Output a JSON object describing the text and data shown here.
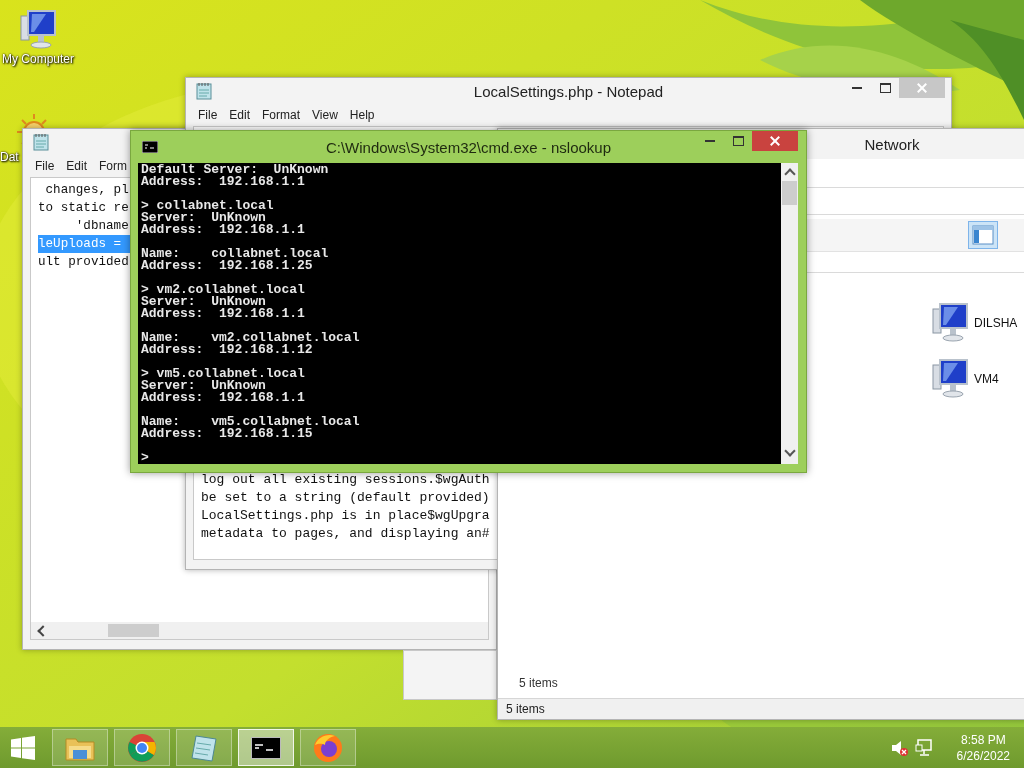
{
  "desktop": {
    "icons": [
      {
        "label": "My Computer",
        "kind": "computer"
      },
      {
        "label": "Dat",
        "kind": "sun"
      }
    ]
  },
  "notepad_left": {
    "menu": [
      "File",
      "Edit",
      "Form"
    ],
    "lines": [
      {
        "text": " changes, pl",
        "selected": false
      },
      {
        "text": "to static re",
        "selected": false
      },
      {
        "text": "     'dbname",
        "selected": false
      },
      {
        "text": "leUploads =",
        "selected": true
      },
      {
        "text": "ult provided",
        "selected": false
      }
    ]
  },
  "notepad_main": {
    "title": "LocalSettings.php - Notepad",
    "menu": [
      "File",
      "Edit",
      "Format",
      "View",
      "Help"
    ],
    "lines": [
      "log out all existing sessions.$wgAuth",
      "be set to a string (default provided)",
      "LocalSettings.php is in place$wgUpgra",
      "metadata to pages, and displaying an#"
    ]
  },
  "network_window": {
    "title": "Network",
    "items": [
      {
        "label": "DILSHA"
      },
      {
        "label": "VM4"
      }
    ],
    "item_count": "5 items",
    "status": "5 items"
  },
  "console": {
    "title": "C:\\Windows\\System32\\cmd.exe - nslookup",
    "blocks": [
      [
        "Default Server:  UnKnown",
        "Address:  192.168.1.1"
      ],
      [
        "> collabnet.local",
        "Server:  UnKnown",
        "Address:  192.168.1.1"
      ],
      [
        "Name:    collabnet.local",
        "Address:  192.168.1.25"
      ],
      [
        "> vm2.collabnet.local",
        "Server:  UnKnown",
        "Address:  192.168.1.1"
      ],
      [
        "Name:    vm2.collabnet.local",
        "Address:  192.168.1.12"
      ],
      [
        "> vm5.collabnet.local",
        "Server:  UnKnown",
        "Address:  192.168.1.1"
      ],
      [
        "Name:    vm5.collabnet.local",
        "Address:  192.168.1.15"
      ],
      [
        ">"
      ]
    ]
  },
  "taskbar": {
    "apps": [
      {
        "kind": "folder",
        "active": false
      },
      {
        "kind": "wheel",
        "active": false
      },
      {
        "kind": "notepad",
        "active": false
      },
      {
        "kind": "console",
        "active": true
      },
      {
        "kind": "fox",
        "active": false
      }
    ],
    "clock": {
      "time": "8:58 PM",
      "date": "6/26/2022"
    }
  }
}
